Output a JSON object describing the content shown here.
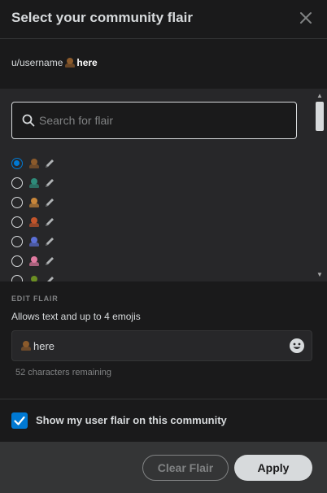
{
  "header": {
    "title": "Select your community flair"
  },
  "preview": {
    "username": "u/username",
    "flair_text": "here"
  },
  "search": {
    "placeholder": "Search for flair"
  },
  "flair_options": [
    {
      "emoji_color": "#8b5a2b",
      "selected": true
    },
    {
      "emoji_color": "#2e8b7a",
      "selected": false
    },
    {
      "emoji_color": "#c8863a",
      "selected": false
    },
    {
      "emoji_color": "#c4552b",
      "selected": false
    },
    {
      "emoji_color": "#5b6fd6",
      "selected": false
    },
    {
      "emoji_color": "#e07aa0",
      "selected": false
    },
    {
      "emoji_color": "#6b8e23",
      "selected": false
    }
  ],
  "edit": {
    "section_label": "EDIT FLAIR",
    "help": "Allows text and up to 4 emojis",
    "value": "here",
    "remaining": "52 characters remaining"
  },
  "show_flair": {
    "label": "Show my user flair on this community",
    "checked": true
  },
  "footer": {
    "clear_label": "Clear Flair",
    "apply_label": "Apply"
  },
  "colors": {
    "accent": "#0079d3",
    "background": "#1a1a1b",
    "panel": "#272729"
  }
}
